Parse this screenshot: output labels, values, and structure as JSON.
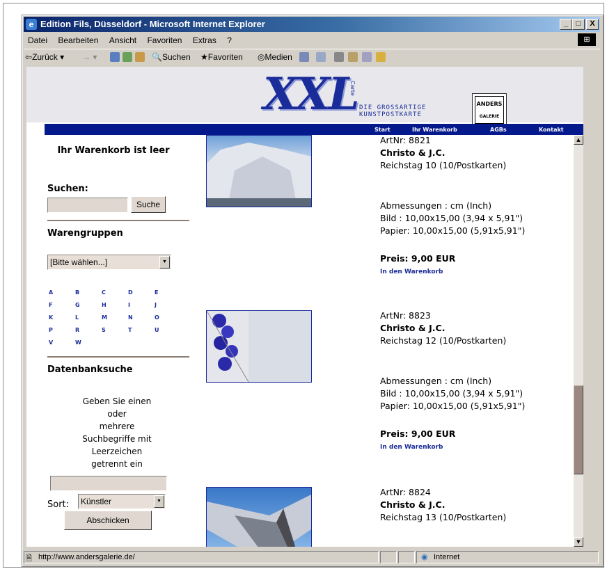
{
  "window": {
    "title": "Edition Fils, Düsseldorf - Microsoft Internet Explorer",
    "controls": {
      "minimize": "_",
      "maximize": "□",
      "close": "X"
    }
  },
  "menubar": [
    "Datei",
    "Bearbeiten",
    "Ansicht",
    "Favoriten",
    "Extras",
    "?"
  ],
  "toolbar": {
    "back": "Zurück",
    "search": "Suchen",
    "favorites": "Favoriten",
    "media": "Medien"
  },
  "header": {
    "logo": "XXL",
    "logo_small": "Carte",
    "tagline_1": "DIE GROSSARTIGE",
    "tagline_2": "KUNSTPOSTKARTE",
    "brand": "ANDERS",
    "brand_sub": "GALERIE"
  },
  "nav": [
    "Start",
    "Ihr Warenkorb",
    "AGBs",
    "Kontakt"
  ],
  "sidebar": {
    "cart_status": "Ihr Warenkorb ist leer",
    "search_heading": "Suchen:",
    "search_value": "",
    "search_button": "Suche",
    "groups_heading": "Warengruppen",
    "groups_select": "[Bitte wählen...]",
    "letters": [
      "A",
      "B",
      "C",
      "D",
      "E",
      "F",
      "G",
      "H",
      "I",
      "J",
      "K",
      "L",
      "M",
      "N",
      "O",
      "P",
      "R",
      "S",
      "T",
      "U",
      "V",
      "W"
    ],
    "db_heading": "Datenbanksuche",
    "db_help": [
      "Geben Sie einen",
      "oder",
      "mehrere",
      "Suchbegriffe mit",
      "Leerzeichen",
      "getrennt ein"
    ],
    "db_value": "",
    "sort_label": "Sort:",
    "sort_select": "Künstler",
    "submit": "Abschicken"
  },
  "products": [
    {
      "artnr": "ArtNr: 8821",
      "artist": "Christo & J.C.",
      "name": "Reichstag 10 (10/Postkarten)",
      "dims": "Abmessungen : cm (Inch)",
      "bild": "Bild : 10,00x15,00 (3,94 x 5,91\")",
      "papier": "Papier: 10,00x15,00 (5,91x5,91\")",
      "price": "Preis: 9,00 EUR",
      "cart": "In den Warenkorb"
    },
    {
      "artnr": "ArtNr: 8823",
      "artist": "Christo & J.C.",
      "name": "Reichstag 12 (10/Postkarten)",
      "dims": "Abmessungen : cm (Inch)",
      "bild": "Bild : 10,00x15,00 (3,94 x 5,91\")",
      "papier": "Papier: 10,00x15,00 (5,91x5,91\")",
      "price": "Preis: 9,00 EUR",
      "cart": "In den Warenkorb"
    },
    {
      "artnr": "ArtNr: 8824",
      "artist": "Christo & J.C.",
      "name": "Reichstag 13 (10/Postkarten)"
    }
  ],
  "status": {
    "url": "http://www.andersgalerie.de/",
    "zone": "Internet"
  }
}
